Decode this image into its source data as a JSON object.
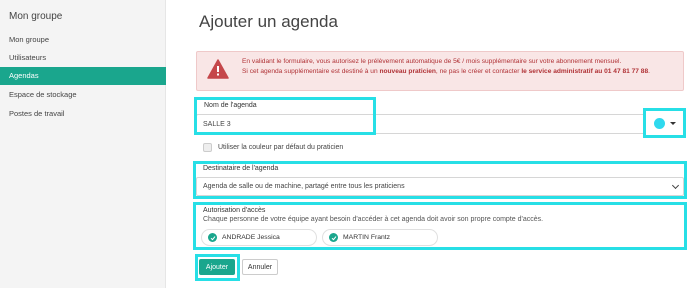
{
  "sidebar": {
    "title": "Mon groupe",
    "items": [
      {
        "label": "Mon groupe"
      },
      {
        "label": "Utilisateurs"
      },
      {
        "label": "Agendas"
      },
      {
        "label": "Espace de stockage"
      },
      {
        "label": "Postes de travail"
      }
    ]
  },
  "page": {
    "title": "Ajouter un agenda"
  },
  "alert": {
    "line1": "En validant le formulaire, vous autorisez le prélèvement automatique de 5€ / mois supplémentaire sur votre abonnement mensuel.",
    "line2_prefix": "Si cet agenda supplémentaire est destiné à un ",
    "line2_bold1": "nouveau praticien",
    "line2_middle": ", ne pas le créer et contacter ",
    "line2_bold2": "le service administratif au 01 47 81 77 88",
    "line2_suffix": "."
  },
  "form": {
    "name_label": "Nom de l'agenda",
    "name_value": "SALLE 3",
    "color_value": "#2fd9ee",
    "default_color_label": "Utiliser la couleur par défaut du praticien",
    "recipient_label": "Destinataire de l'agenda",
    "recipient_value": "Agenda de salle ou de machine, partagé entre tous les praticiens",
    "access_label": "Autorisation d'accès",
    "access_help": "Chaque personne de votre équipe ayant besoin d'accéder à cet agenda doit avoir son propre compte d'accès.",
    "people": [
      {
        "name": "ANDRADE Jessica",
        "checked": true
      },
      {
        "name": "MARTIN Frantz",
        "checked": true
      }
    ]
  },
  "actions": {
    "submit_label": "Ajouter",
    "cancel_label": "Annuler"
  },
  "colors": {
    "accent": "#1aa68d",
    "highlight": "#27dfe6",
    "alert_text": "#b03236",
    "alert_bg": "#f9e6e6"
  }
}
